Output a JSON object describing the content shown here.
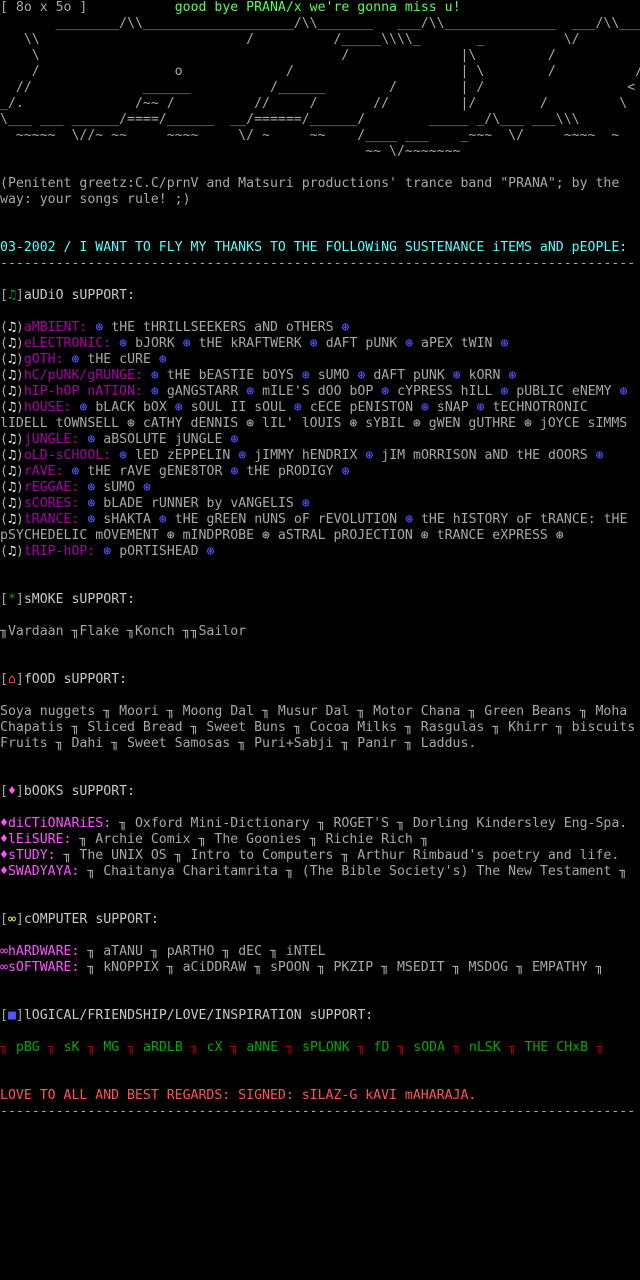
{
  "header": {
    "size": "[ 8o x 5o ]",
    "title": "good bye PRANA/x we're gonna miss u!"
  },
  "logo_art": "       ________/\\\\___________________/\\\\_______   ___/\\\\______________  ___/\\\\___.\n   \\\\                          /          /_____\\\\\\\\_       _          \\/             /\n    \\                                      /              |\\         /             \n    /                 o             /                     | \\        /          //\n  //              ______          /______        /        | /                  <\n_/.              /~~ /          //     /       //         |/        /         \\\n\\___ ___ ______/====/______  __/======/______/        _____ _/\\___ ___\\\\\\\n  ~~~~~  \\//~ ~~     ~~~~     \\/ ~     ~~    /____ ___    _~~~  \\/     ~~~~  ~\n                                              ~~ \\/~~~~~~~",
  "greetz": {
    "line1": "(Penitent greetz:C.C/prnV and Matsuri productions' trance band \"PRANA\"; by the",
    "line2": "way: your songs rule! ;)"
  },
  "thanks_line": "03-2002 / I WANT TO FLY MY THANKS TO THE FOLLOWiNG SUSTENANCE iTEMS aND pEOPLE:",
  "separator": "--------------------------------------------------------------------------------",
  "audio": {
    "icon": "♫",
    "title": "aUDiO sUPPORT:",
    "bullet": "⊛",
    "genres": [
      {
        "label": "aMBIENT:",
        "artists": [
          "tHE tHRILLSEEKERS aND oTHERS"
        ]
      },
      {
        "label": "eLECTRONIC:",
        "artists": [
          "bJORK",
          "tHE kRAFTWERK",
          "dAFT pUNK",
          "aPEX tWIN"
        ]
      },
      {
        "label": "gOTH:",
        "artists": [
          "tHE cURE"
        ]
      },
      {
        "label": "hC/pUNK/gRUNGE:",
        "artists": [
          "tHE bEASTIE bOYS",
          "sUMO",
          "dAFT pUNK",
          "kORN"
        ]
      },
      {
        "label": "hIP-hOP nATION:",
        "artists": [
          "gANGSTARR",
          "mILE'S dOO bOP",
          "cYPRESS hILL",
          "pUBLIC eNEMY"
        ]
      },
      {
        "label": "hOUSE:",
        "artists": [
          "bLACK bOX",
          "sOUL II sOUL",
          "cECE pENISTON",
          "sNAP",
          "tECHNOTRONIC"
        ],
        "cont": "lIDELL tOWNSELL ⊛ cATHY dENNIS ⊛ lIL' lOUIS ⊛ sYBIL ⊛ gWEN gUTHRE ⊛ jOYCE sIMMS"
      },
      {
        "label": "jUNGLE:",
        "artists": [
          "aBSOLUTE jUNGLE"
        ]
      },
      {
        "label": "oLD-sCHOOL:",
        "artists": [
          "lED zEPPELIN",
          "jIMMY hENDRIX",
          "jIM mORRISON aND tHE dOORS"
        ]
      },
      {
        "label": "rAVE:",
        "artists": [
          "tHE rAVE gENE8TOR",
          "tHE pRODIGY"
        ]
      },
      {
        "label": "rEGGAE:",
        "artists": [
          "sUMO"
        ]
      },
      {
        "label": "sCORES:",
        "artists": [
          "bLADE rUNNER by vANGELIS"
        ]
      },
      {
        "label": "tRANCE:",
        "artists": [
          "sHAKTA",
          "tHE gREEN nUNS oF rEVOLUTION",
          "tHE hISTORY oF tRANCE: tHE"
        ],
        "cont": "pSYCHEDELIC mOVEMENT ⊛ mINDPROBE ⊛ aSTRAL pROJECTION ⊛ tRANCE eXPRESS ⊛"
      },
      {
        "label": "tRIP-hOP:",
        "artists": [
          "pORTISHEAD"
        ]
      }
    ]
  },
  "smoke": {
    "icon": "*",
    "title": "sMOKE sUPPORT:",
    "line": "╖Vardaan ╖Flake ╖Konch ╖╖Sailor"
  },
  "food": {
    "icon": "⌂",
    "title": "fOOD sUPPORT:",
    "lines": [
      "Soya nuggets ╖ Moori ╖ Moong Dal ╖ Musur Dal ╖ Motor Chana ╖ Green Beans ╖ Moha",
      "Chapatis ╖ Sliced Bread ╖ Sweet Buns ╖ Cocoa Milks ╖ Rasgulas ╖ Khirr ╖ biscuits",
      "Fruits ╖ Dahi ╖ Sweet Samosas ╖ Puri+Sabji ╖ Panir ╖ Laddus."
    ]
  },
  "books": {
    "icon": "♦",
    "title": "bOOKS sUPPORT:",
    "items": [
      {
        "label": "♦diCTiONARiES:",
        "text": " ╖ Oxford Mini-Dictionary ╖ ROGET'S ╖ Dorling Kindersley Eng-Spa."
      },
      {
        "label": "♦lEiSURE:",
        "text": " ╖ Archie Comix ╖ The Goonies ╖ Richie Rich ╖"
      },
      {
        "label": "♦sTUDY:",
        "text": " ╖ The UNIX OS ╖ Intro to Computers ╖ Arthur Rimbaud's poetry and life."
      },
      {
        "label": "♦SWADYAYA:",
        "text": " ╖ Chaitanya Charitamrita ╖ (The Bible Society's) The New Testament ╖"
      }
    ]
  },
  "computer": {
    "icon": "∞",
    "title": "cOMPUTER sUPPORT:",
    "items": [
      {
        "label": "∞hARDWARE:",
        "text": " ╖ aTANU ╖ pARTHO ╖ dEC ╖ iNTEL"
      },
      {
        "label": "∞sOFTWARE:",
        "text": " ╖ kNOPPIX ╖ aCiDDRAW ╖ sPOON ╖ PKZIP ╖ MSEDIT ╖ MSDOG ╖ EMPATHY ╖"
      }
    ]
  },
  "logical": {
    "icon": "■",
    "title": "lOGICAL/FRIENDSHIP/LOVE/INSPIRATION sUPPORT:",
    "names": [
      "pBG",
      "sK",
      "MG",
      "aRDLB",
      "cX",
      "aNNE",
      "sPLONK",
      "fD",
      "sODA",
      "nLSK",
      "THE CHxB"
    ]
  },
  "signoff": "LOVE TO ALL AND BEST REGARDS: SIGNED: sILAZ-G kAVI mAHARAJA.",
  "colors": {
    "background": "#000000",
    "text": "#a8a8a8",
    "magenta": "#ff55ff",
    "cyan": "#55ffff",
    "green": "#55ff55",
    "red": "#ff5555",
    "blue": "#5555ff"
  }
}
